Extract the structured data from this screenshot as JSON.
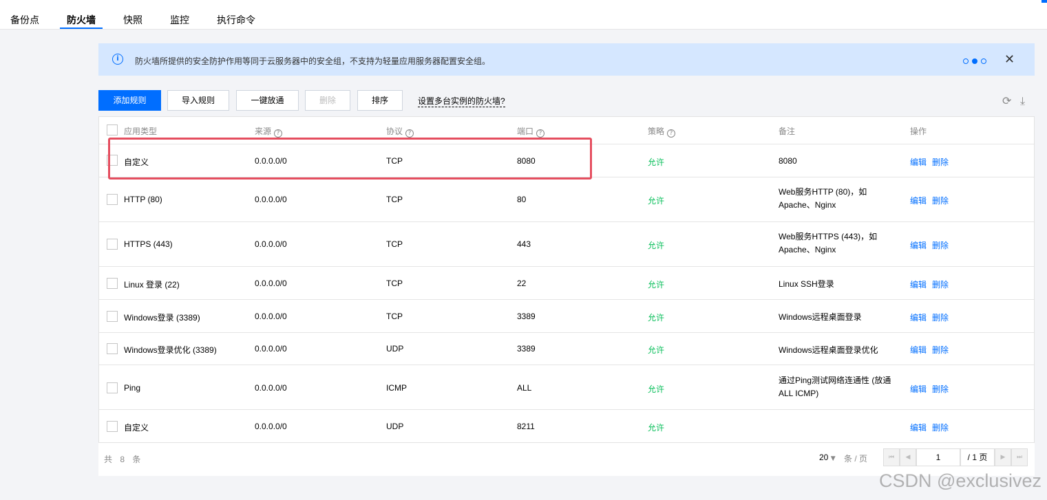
{
  "tabs": [
    {
      "label": "备份点"
    },
    {
      "label": "防火墙"
    },
    {
      "label": "快照"
    },
    {
      "label": "监控"
    },
    {
      "label": "执行命令"
    }
  ],
  "notice": {
    "text": "防火墙所提供的安全防护作用等同于云服务器中的安全组，不支持为轻量应用服务器配置安全组。",
    "info_icon": "i",
    "close_icon": "✕"
  },
  "toolbar": {
    "add_label": "添加规则",
    "import_label": "导入规则",
    "quick_label": "一键放通",
    "delete_label": "删除",
    "sort_label": "排序",
    "multi_link": "设置多台实例的防火墙?",
    "refresh_icon": "⟳",
    "download_icon": "⤓"
  },
  "table": {
    "headers": {
      "type": "应用类型",
      "source": "来源",
      "protocol": "协议",
      "port": "端口",
      "policy": "策略",
      "remark": "备注",
      "ops": "操作"
    },
    "help_icon": "?",
    "rows": [
      {
        "type": "自定义",
        "source": "0.0.0.0/0",
        "protocol": "TCP",
        "port": "8080",
        "policy": "允许",
        "remark": "8080",
        "edit": "编辑",
        "del": "删除"
      },
      {
        "type": "HTTP (80)",
        "source": "0.0.0.0/0",
        "protocol": "TCP",
        "port": "80",
        "policy": "允许",
        "remark": "Web服务HTTP (80)，如Apache、Nginx",
        "edit": "编辑",
        "del": "删除"
      },
      {
        "type": "HTTPS (443)",
        "source": "0.0.0.0/0",
        "protocol": "TCP",
        "port": "443",
        "policy": "允许",
        "remark": "Web服务HTTPS (443)，如Apache、Nginx",
        "edit": "编辑",
        "del": "删除"
      },
      {
        "type": "Linux 登录 (22)",
        "source": "0.0.0.0/0",
        "protocol": "TCP",
        "port": "22",
        "policy": "允许",
        "remark": "Linux SSH登录",
        "edit": "编辑",
        "del": "删除"
      },
      {
        "type": "Windows登录 (3389)",
        "source": "0.0.0.0/0",
        "protocol": "TCP",
        "port": "3389",
        "policy": "允许",
        "remark": "Windows远程桌面登录",
        "edit": "编辑",
        "del": "删除"
      },
      {
        "type": "Windows登录优化 (3389)",
        "source": "0.0.0.0/0",
        "protocol": "UDP",
        "port": "3389",
        "policy": "允许",
        "remark": "Windows远程桌面登录优化",
        "edit": "编辑",
        "del": "删除"
      },
      {
        "type": "Ping",
        "source": "0.0.0.0/0",
        "protocol": "ICMP",
        "port": "ALL",
        "policy": "允许",
        "remark": "通过Ping测试网络连通性 (放通ALL ICMP)",
        "edit": "编辑",
        "del": "删除"
      },
      {
        "type": "自定义",
        "source": "0.0.0.0/0",
        "protocol": "UDP",
        "port": "8211",
        "policy": "允许",
        "remark": "",
        "edit": "编辑",
        "del": "删除"
      }
    ]
  },
  "footer": {
    "total": "共 8 条",
    "page_size": "20",
    "page_unit": "条 / 页",
    "current_page": "1",
    "total_pages": "/ 1 页"
  },
  "watermark": "CSDN @exclusivez",
  "colors": {
    "primary": "#006eff",
    "allow": "#0abf5b",
    "highlight": "#e54e5f",
    "notice_bg": "#d5e7ff"
  }
}
